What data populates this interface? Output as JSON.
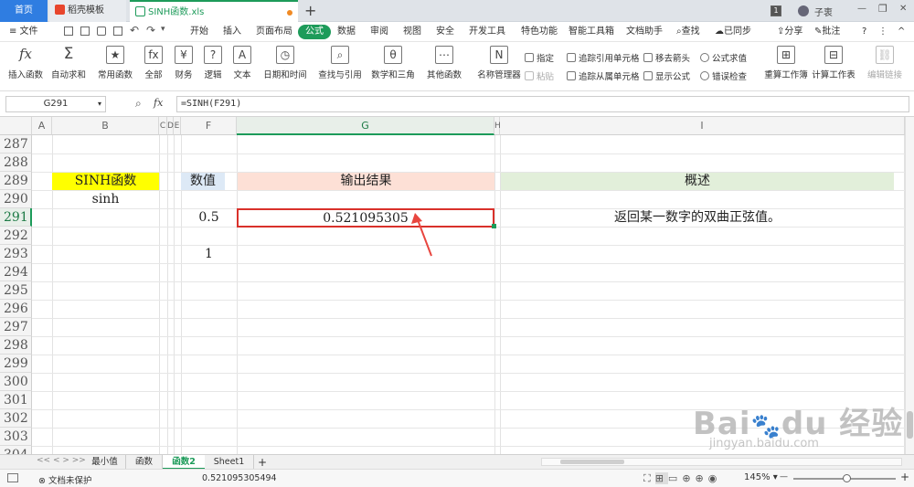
{
  "tabs": {
    "home": "首页",
    "daoke": "稻壳模板",
    "file": "SINH函数.xls",
    "add": "+",
    "page_count": "1",
    "user": "子衷",
    "win_min": "—",
    "win_max": "❐",
    "win_close": "✕"
  },
  "menu": {
    "file_menu": "≡ 文件",
    "items": [
      "开始",
      "插入",
      "页面布局",
      "公式",
      "数据",
      "审阅",
      "视图",
      "安全",
      "开发工具",
      "特色功能",
      "智能工具箱",
      "文档助手"
    ],
    "search": "查找",
    "sync": "已同步",
    "share": "分享",
    "comment": "批注",
    "help": "?",
    "more": "⋮",
    "collapse": "^"
  },
  "toolbar": {
    "insert_function": "插入函数",
    "autosum": "自动求和",
    "common_func": "常用函数",
    "all": "全部",
    "finance": "财务",
    "logic": "逻辑",
    "text": "文本",
    "datetime": "日期和时间",
    "lookup": "查找与引用",
    "math": "数学和三角",
    "other": "其他函数",
    "name_manager": "名称管理器",
    "specify": "指定",
    "paste": "粘贴",
    "trace_precedents": "追踪引用单元格",
    "trace_dependents": "追踪从属单元格",
    "remove_arrows": "移去箭头",
    "show_formula": "显示公式",
    "evaluate": "公式求值",
    "error_check": "错误检查",
    "recalc_book": "重算工作簿",
    "calc_sheet": "计算工作表",
    "edit_links": "编辑链接"
  },
  "formula_bar": {
    "name_box": "G291",
    "fx": "fx",
    "formula": "=SINH(F291)"
  },
  "columns": [
    "A",
    "B",
    "C",
    "D",
    "E",
    "F",
    "G",
    "H",
    "I"
  ],
  "rows": [
    "287",
    "288",
    "289",
    "290",
    "291",
    "292",
    "293",
    "294",
    "295",
    "296",
    "297",
    "298",
    "299",
    "300",
    "301",
    "302",
    "303",
    "304"
  ],
  "cells": {
    "b289": "SINH函数",
    "b290": "sinh",
    "f289": "数值",
    "f291": "0.5",
    "f293": "1",
    "g289": "输出结果",
    "g291": "0.521095305",
    "i289": "概述",
    "i291": "返回某一数字的双曲正弦值。"
  },
  "sheets": [
    "最小值",
    "函数",
    "函数2",
    "Sheet1"
  ],
  "active_sheet": "函数2",
  "status": {
    "protect": "文档未保护",
    "value": "0.521095305494",
    "zoom": "145%",
    "minus": "—",
    "plus": "+"
  },
  "watermark": {
    "logo": "Bai du 经验",
    "url": "jingyan.baidu.com"
  },
  "colors": {
    "formula_tab": "#1d9b5a",
    "b289_fill": "#ffff00",
    "f289_fill": "#dde9f6",
    "g289_fill": "#fde0d6",
    "i289_fill": "#e2efda",
    "selection": "#d9312b",
    "arrow": "#e8463f"
  }
}
